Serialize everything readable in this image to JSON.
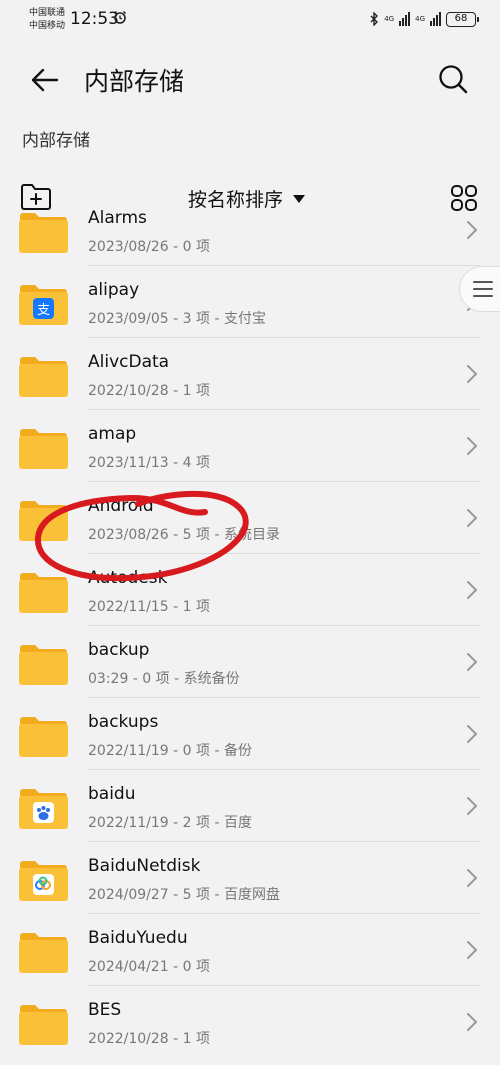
{
  "status_bar": {
    "carrier1": "中国联通",
    "carrier2": "中国移动",
    "time": "12:53",
    "net1": "4G",
    "net2": "4G",
    "battery": "68"
  },
  "header": {
    "title": "内部存储",
    "back_icon": "back-arrow-icon",
    "search_icon": "search-icon"
  },
  "breadcrumb": "内部存储",
  "toolbar": {
    "sort_label": "按名称排序",
    "new_folder_icon": "new-folder-icon",
    "grid_icon": "grid-view-icon"
  },
  "files": [
    {
      "name": "Alarms",
      "meta": "2023/08/26 - 0 项",
      "icon": "folder"
    },
    {
      "name": "alipay",
      "meta": "2023/09/05 - 3 项 - 支付宝",
      "icon": "alipay"
    },
    {
      "name": "AlivcData",
      "meta": "2022/10/28 - 1 项",
      "icon": "folder"
    },
    {
      "name": "amap",
      "meta": "2023/11/13 - 4 项",
      "icon": "folder"
    },
    {
      "name": "Android",
      "meta": "2023/08/26 - 5 项 - 系统目录",
      "icon": "folder"
    },
    {
      "name": "Autodesk",
      "meta": "2022/11/15 - 1 项",
      "icon": "folder"
    },
    {
      "name": "backup",
      "meta": "03:29 - 0 项 - 系统备份",
      "icon": "folder"
    },
    {
      "name": "backups",
      "meta": "2022/11/19 - 0 项 - 备份",
      "icon": "folder"
    },
    {
      "name": "baidu",
      "meta": "2022/11/19 - 2 项 - 百度",
      "icon": "baidu"
    },
    {
      "name": "BaiduNetdisk",
      "meta": "2024/09/27 - 5 项 - 百度网盘",
      "icon": "netdisk"
    },
    {
      "name": "BaiduYuedu",
      "meta": "2024/04/21 - 0 项",
      "icon": "folder"
    },
    {
      "name": "BES",
      "meta": "2022/10/28 - 1 项",
      "icon": "folder"
    }
  ],
  "colors": {
    "folder": "#f9c038",
    "folder_back": "#f2ad1d",
    "annotation": "#d8191d",
    "alipay": "#1677ff"
  }
}
